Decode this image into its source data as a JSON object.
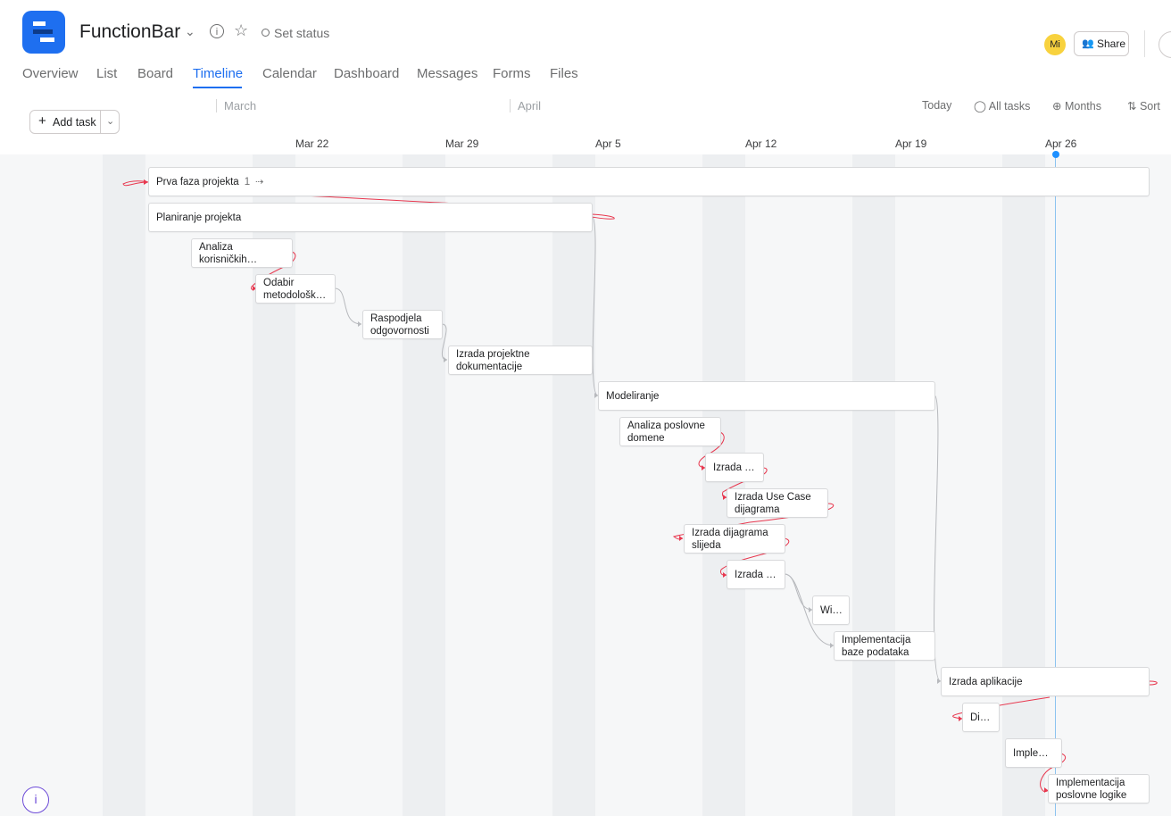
{
  "project": {
    "title": "FunctionBar",
    "set_status": "Set status"
  },
  "header": {
    "avatar_initials": "Mi",
    "share_label": "Share"
  },
  "tabs": [
    "Overview",
    "List",
    "Board",
    "Timeline",
    "Calendar",
    "Dashboard",
    "Messages",
    "Forms",
    "Files"
  ],
  "active_tab": "Timeline",
  "toolbar": {
    "add_task_label": "Add task",
    "today_label": "Today",
    "all_tasks_label": "All tasks",
    "months_label": "Months",
    "sort_label": "Sort"
  },
  "months": [
    "March",
    "April"
  ],
  "weeks": [
    "Mar 22",
    "Mar 29",
    "Apr 5",
    "Apr 12",
    "Apr 19",
    "Apr 26"
  ],
  "tasks": {
    "prva_faza": {
      "name": "Prva faza projekta",
      "subtask_count": "1"
    },
    "planiranje": "Planiranje projekta",
    "analiza_korisnickih": "Analiza korisničkih…",
    "odabir": "Odabir metodološk…",
    "raspodjela": "Raspodjela odgovornosti",
    "izrada_dok": "Izrada projektne dokumentacije",
    "modeliranje": "Modeliranje",
    "analiza_domene": "Analiza poslovne domene",
    "izrada_1": "Izrada …",
    "use_case": "Izrada Use Case dijagrama",
    "slijeda": "Izrada dijagrama slijeda",
    "izrada_2": "Izrada …",
    "wi": "Wi…",
    "impl_baze": "Implementacija baze podataka",
    "izrada_aplikacije": "Izrada aplikacije",
    "di": "Di…",
    "imple": "Imple…",
    "impl_logike": "Implementacija poslovne logike"
  },
  "colors": {
    "accent": "#1e6ff0",
    "dependency_conflict": "#e8384f",
    "dependency_normal": "#b7b9bd",
    "today": "#1e90ff"
  }
}
